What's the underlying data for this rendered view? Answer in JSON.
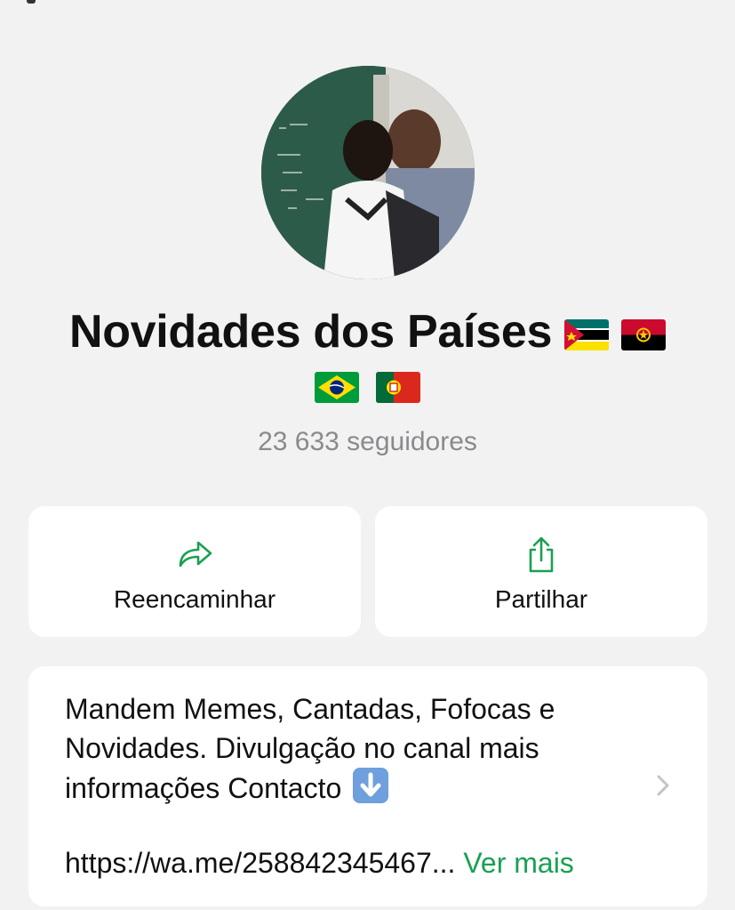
{
  "channel": {
    "name": "Novidades dos Países",
    "followers": "23 633 seguidores"
  },
  "actions": {
    "forward_label": "Reencaminhar",
    "share_label": "Partilhar"
  },
  "description": {
    "text": "Mandem Memes, Cantadas, Fofocas e Novidades. Divulgação no canal mais informações Contacto",
    "link": "https://wa.me/258842345467...",
    "see_more": "Ver mais"
  },
  "colors": {
    "accent": "#1aa053",
    "background": "#f2f2f2",
    "card": "#ffffff",
    "muted": "#8a8a8e"
  },
  "icons": [
    "forward-arrow-icon",
    "share-icon",
    "chevron-right-icon",
    "down-arrow-emoji-icon"
  ]
}
